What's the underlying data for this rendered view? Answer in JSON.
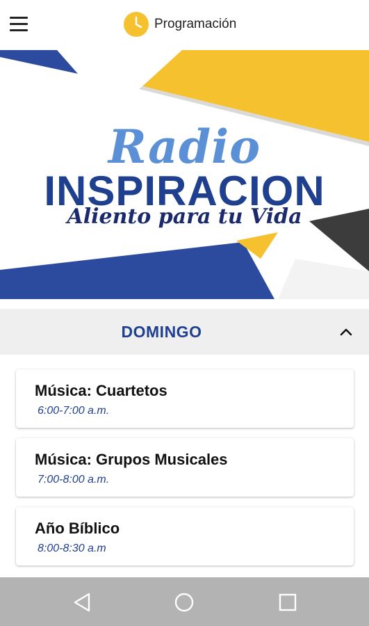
{
  "header": {
    "menu_icon": "hamburger-icon",
    "clock_icon": "clock-icon",
    "title": "Programación"
  },
  "banner": {
    "logo_line1": "Radio",
    "logo_line2": "INSPIRACION",
    "logo_tagline": "Aliento para tu Vida",
    "colors": {
      "yellow": "#f6c12f",
      "blue": "#2c4a9e",
      "dark": "#3c3c3c"
    }
  },
  "schedule": {
    "day": "DOMINGO",
    "toggle_icon": "chevron-up-icon",
    "items": [
      {
        "title": "Música: Cuartetos",
        "time": "6:00-7:00 a.m."
      },
      {
        "title": "Música: Grupos Musicales",
        "time": "7:00-8:00 a.m."
      },
      {
        "title": "Año Bíblico",
        "time": "8:00-8:30 a.m"
      }
    ]
  },
  "system_nav": {
    "back_icon": "back-triangle-icon",
    "home_icon": "home-circle-icon",
    "recents_icon": "recents-square-icon"
  },
  "theme": {
    "accent": "#1f3f8f",
    "header_bg": "#efefef",
    "navbar_bg": "#b3b3b3"
  }
}
